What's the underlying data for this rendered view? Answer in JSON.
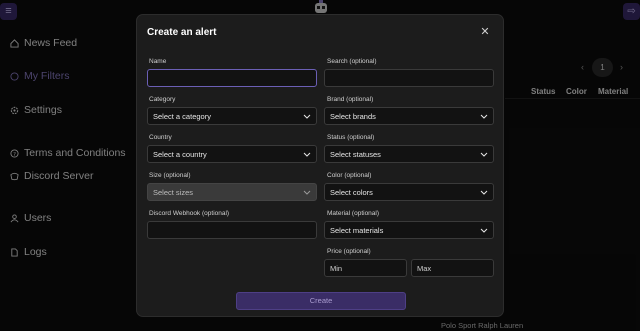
{
  "sidebar": {
    "items": [
      {
        "label": "News Feed",
        "icon": "home-icon"
      },
      {
        "label": "My Filters",
        "icon": "filter-icon",
        "active": true
      },
      {
        "label": "Settings",
        "icon": "gear-icon"
      },
      {
        "label": "Terms and Conditions",
        "icon": "help-icon"
      },
      {
        "label": "Discord Server",
        "icon": "discord-icon"
      },
      {
        "label": "Users",
        "icon": "user-icon"
      },
      {
        "label": "Logs",
        "icon": "file-icon"
      }
    ]
  },
  "pagination": {
    "current_page": "1"
  },
  "table": {
    "headers": [
      "Status",
      "Color",
      "Material"
    ]
  },
  "background_item_text": "Polo Sport Ralph Lauren",
  "colors": {
    "accent": "#3a2a68",
    "modal_bg": "#1c1c1c",
    "field_bg": "#121212",
    "focus": "#6b5fb5"
  },
  "modal": {
    "title": "Create an alert",
    "fields": {
      "name": {
        "label": "Name",
        "value": ""
      },
      "search": {
        "label": "Search (optional)",
        "value": ""
      },
      "category": {
        "label": "Category",
        "value": "Select a category"
      },
      "brand": {
        "label": "Brand (optional)",
        "value": "Select brands"
      },
      "country": {
        "label": "Country",
        "value": "Select a country"
      },
      "status": {
        "label": "Status (optional)",
        "value": "Select statuses"
      },
      "size": {
        "label": "Size (optional)",
        "value": "Select sizes"
      },
      "color": {
        "label": "Color (optional)",
        "value": "Select colors"
      },
      "webhook": {
        "label": "Discord Webhook (optional)",
        "value": ""
      },
      "material": {
        "label": "Material (optional)",
        "value": "Select materials"
      },
      "price": {
        "label": "Price (optional)",
        "min_placeholder": "Min",
        "max_placeholder": "Max"
      }
    },
    "create_label": "Create"
  }
}
